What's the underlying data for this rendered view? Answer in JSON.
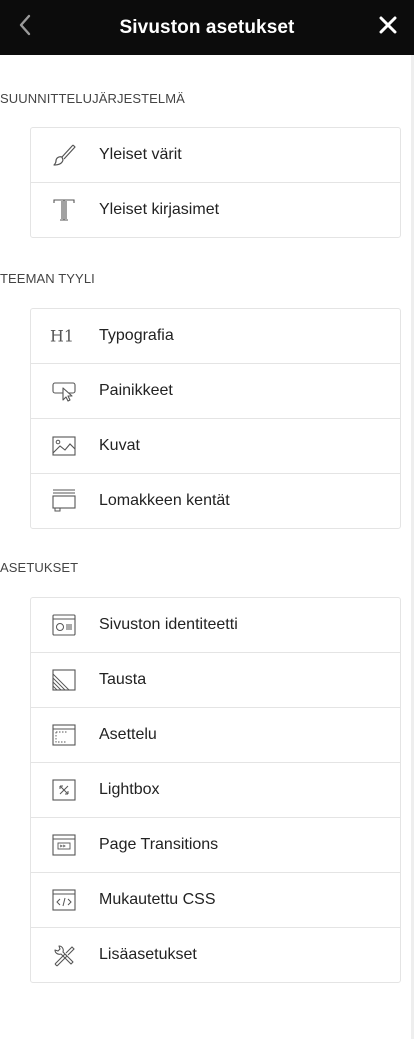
{
  "header": {
    "title": "Sivuston asetukset"
  },
  "sections": [
    {
      "label": "SUUNNITTELUJÄRJESTELMÄ",
      "items": [
        {
          "label": "Yleiset värit",
          "icon": "brush-icon"
        },
        {
          "label": "Yleiset kirjasimet",
          "icon": "typeface-icon"
        }
      ]
    },
    {
      "label": "TEEMAN TYYLI",
      "items": [
        {
          "label": "Typografia",
          "icon": "h1-icon"
        },
        {
          "label": "Painikkeet",
          "icon": "button-cursor-icon"
        },
        {
          "label": "Kuvat",
          "icon": "image-icon"
        },
        {
          "label": "Lomakkeen kentät",
          "icon": "form-field-icon"
        }
      ]
    },
    {
      "label": "ASETUKSET",
      "items": [
        {
          "label": "Sivuston identiteetti",
          "icon": "identity-icon"
        },
        {
          "label": "Tausta",
          "icon": "background-icon"
        },
        {
          "label": "Asettelu",
          "icon": "layout-icon"
        },
        {
          "label": "Lightbox",
          "icon": "lightbox-icon"
        },
        {
          "label": "Page Transitions",
          "icon": "page-transitions-icon"
        },
        {
          "label": "Mukautettu CSS",
          "icon": "code-icon"
        },
        {
          "label": "Lisäasetukset",
          "icon": "tools-icon"
        }
      ]
    }
  ],
  "colors": {
    "topbar": "#0c0c0c",
    "border": "#e4e4e4",
    "text": "#222222"
  }
}
